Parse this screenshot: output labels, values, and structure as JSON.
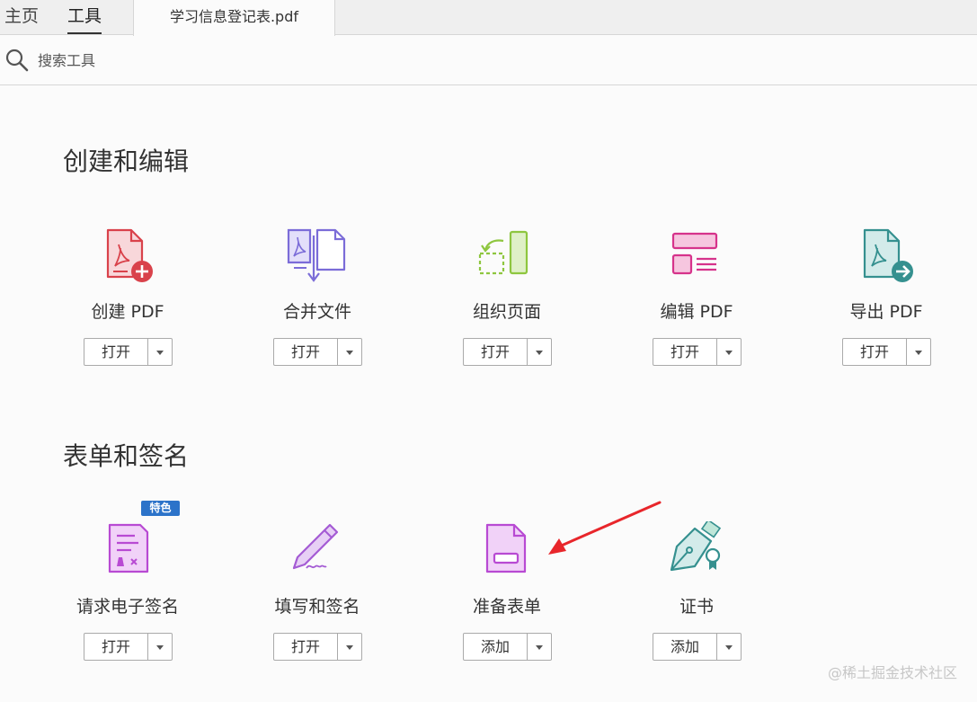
{
  "nav": {
    "home_label": "主页",
    "tools_label": "工具",
    "document_tab": "学习信息登记表.pdf"
  },
  "search": {
    "placeholder": "搜索工具"
  },
  "sections": [
    {
      "title": "创建和编辑",
      "tools": [
        {
          "label": "创建 PDF",
          "button": "打开",
          "icon": "create-pdf-icon"
        },
        {
          "label": "合并文件",
          "button": "打开",
          "icon": "combine-files-icon"
        },
        {
          "label": "组织页面",
          "button": "打开",
          "icon": "organize-pages-icon"
        },
        {
          "label": "编辑 PDF",
          "button": "打开",
          "icon": "edit-pdf-icon"
        },
        {
          "label": "导出 PDF",
          "button": "打开",
          "icon": "export-pdf-icon"
        }
      ]
    },
    {
      "title": "表单和签名",
      "tools": [
        {
          "label": "请求电子签名",
          "button": "打开",
          "icon": "request-esign-icon",
          "badge": "特色"
        },
        {
          "label": "填写和签名",
          "button": "打开",
          "icon": "fill-sign-icon"
        },
        {
          "label": "准备表单",
          "button": "添加",
          "icon": "prepare-form-icon"
        },
        {
          "label": "证书",
          "button": "添加",
          "icon": "certificates-icon"
        }
      ]
    }
  ],
  "colors": {
    "create_pdf": "#d9424b",
    "combine": "#7b6cd8",
    "organize": "#8ec63f",
    "edit_pdf": "#d6338b",
    "export_pdf": "#35908f",
    "forms_purple": "#b84ad3",
    "badge": "#2c73c9",
    "arrow": "#e8262b"
  },
  "watermark": "@稀土掘金技术社区"
}
